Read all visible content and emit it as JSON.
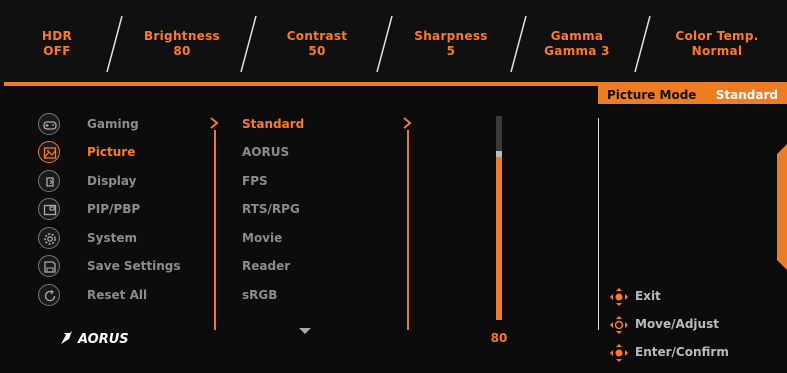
{
  "status_bar": [
    {
      "label": "HDR",
      "value": "OFF"
    },
    {
      "label": "Brightness",
      "value": "80"
    },
    {
      "label": "Contrast",
      "value": "50"
    },
    {
      "label": "Sharpness",
      "value": "5"
    },
    {
      "label": "Gamma",
      "value": "Gamma 3"
    },
    {
      "label": "Color Temp.",
      "value": "Normal"
    }
  ],
  "current_tab": {
    "label": "Picture Mode",
    "value": "Standard"
  },
  "main_menu": [
    {
      "label": "Gaming",
      "icon": "gamepad-icon",
      "active": false
    },
    {
      "label": "Picture",
      "icon": "picture-icon",
      "active": true
    },
    {
      "label": "Display",
      "icon": "display-icon",
      "active": false
    },
    {
      "label": "PIP/PBP",
      "icon": "pip-icon",
      "active": false
    },
    {
      "label": "System",
      "icon": "gear-icon",
      "active": false
    },
    {
      "label": "Save Settings",
      "icon": "save-icon",
      "active": false
    },
    {
      "label": "Reset All",
      "icon": "reset-icon",
      "active": false
    }
  ],
  "picture_modes": [
    "Standard",
    "AORUS",
    "FPS",
    "RTS/RPG",
    "Movie",
    "Reader",
    "sRGB"
  ],
  "selected_mode": "Standard",
  "brand_logo": "AORUS",
  "value_slider": {
    "value": "80",
    "level": 0.8
  },
  "help": [
    {
      "label": "Exit",
      "icon": "joystick-exit-icon"
    },
    {
      "label": "Move/Adjust",
      "icon": "joystick-move-icon"
    },
    {
      "label": "Enter/Confirm",
      "icon": "joystick-enter-icon"
    }
  ],
  "colors": {
    "accent": "#ee7c22",
    "text_accent": "#ff7a1a",
    "muted": "#8c8c8c",
    "background": "#0c0c0c"
  }
}
